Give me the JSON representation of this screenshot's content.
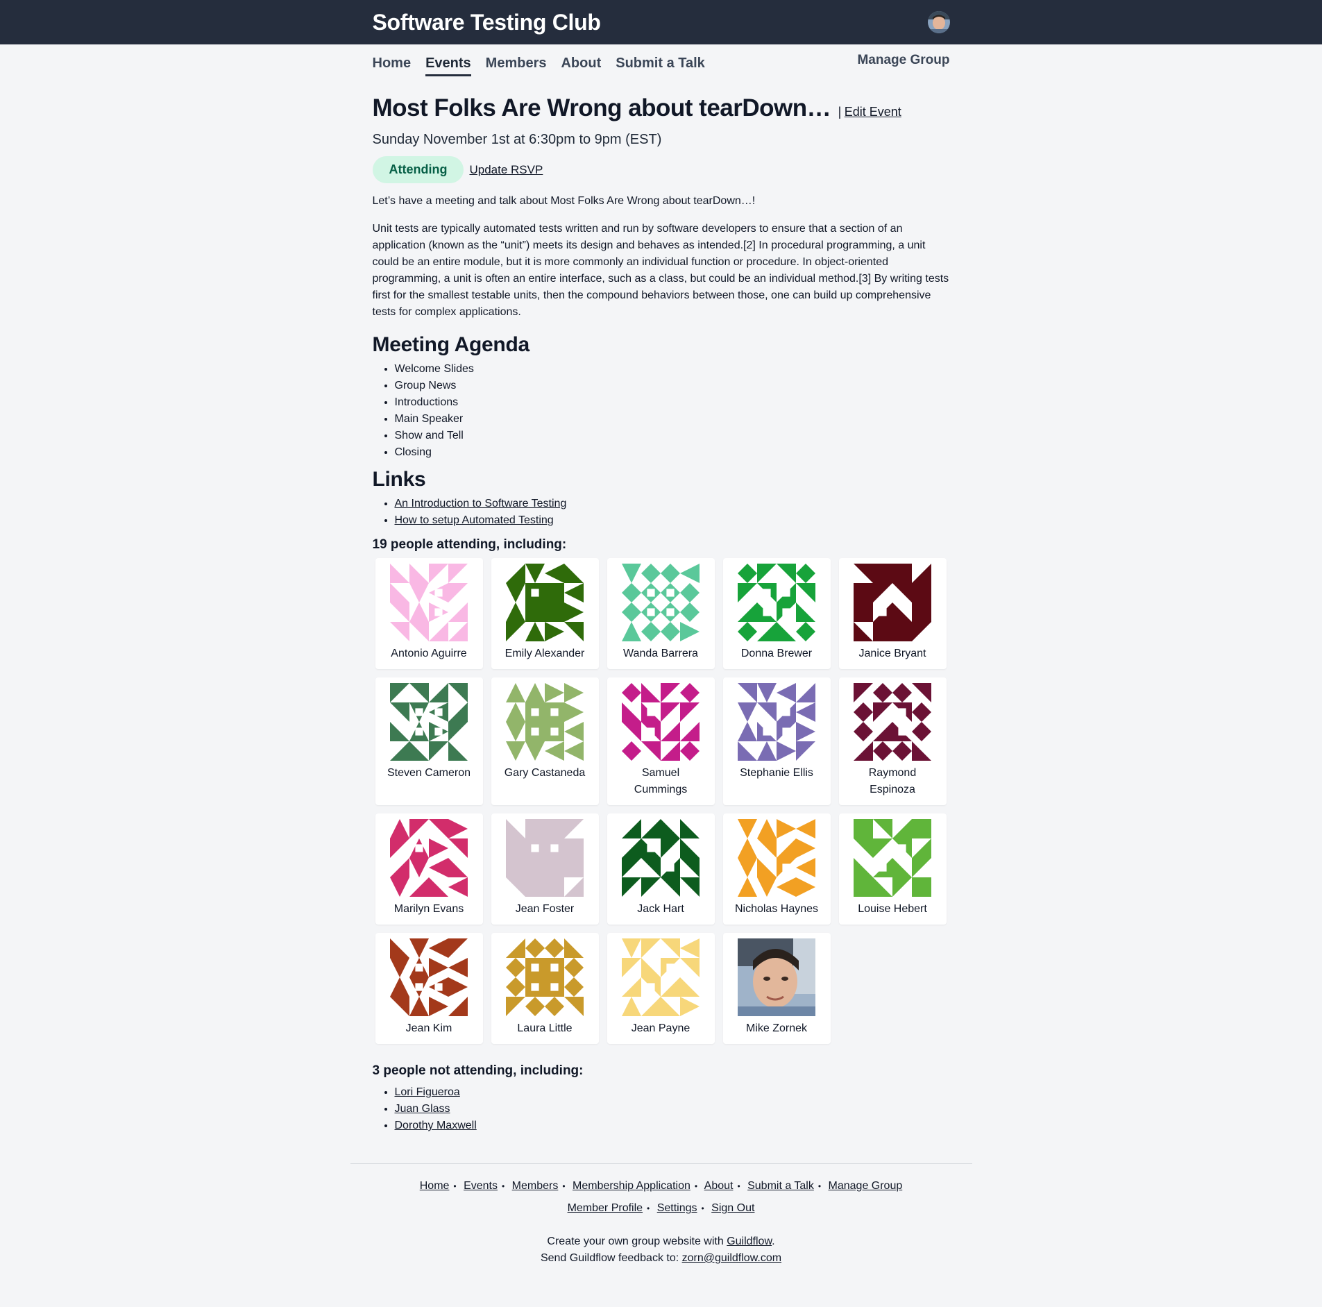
{
  "header": {
    "site_title": "Software Testing Club"
  },
  "nav": {
    "items": [
      {
        "label": "Home"
      },
      {
        "label": "Events"
      },
      {
        "label": "Members"
      },
      {
        "label": "About"
      },
      {
        "label": "Submit a Talk"
      }
    ],
    "active": "Events",
    "manage_label": "Manage Group"
  },
  "event": {
    "title": "Most Folks Are Wrong about tearDown…",
    "separator": "|",
    "edit_label": "Edit Event",
    "datetime": "Sunday November 1st at 6:30pm to 9pm (EST)",
    "status_badge": "Attending",
    "update_rsvp_label": "Update RSVP",
    "intro": "Let’s have a meeting and talk about Most Folks Are Wrong about tearDown…!",
    "description": "Unit tests are typically automated tests written and run by software developers to ensure that a section of an application (known as the “unit”) meets its design and behaves as intended.[2] In procedural programming, a unit could be an entire module, but it is more commonly an individual function or procedure. In object-oriented programming, a unit is often an entire interface, such as a class, but could be an individual method.[3] By writing tests first for the smallest testable units, then the compound behaviors between those, one can build up comprehensive tests for complex applications."
  },
  "agenda": {
    "heading": "Meeting Agenda",
    "items": [
      "Welcome Slides",
      "Group News",
      "Introductions",
      "Main Speaker",
      "Show and Tell",
      "Closing"
    ]
  },
  "links": {
    "heading": "Links",
    "items": [
      "An Introduction to Software Testing",
      "How to setup Automated Testing"
    ]
  },
  "attending": {
    "heading": "19 people attending, including:",
    "people": [
      {
        "name": "Antonio Aguirre",
        "color": "#f9b8e4"
      },
      {
        "name": "Emily Alexander",
        "color": "#2f6b0a"
      },
      {
        "name": "Wanda Barrera",
        "color": "#5ac89a"
      },
      {
        "name": "Donna Brewer",
        "color": "#17a33a"
      },
      {
        "name": "Janice Bryant",
        "color": "#5c0a14"
      },
      {
        "name": "Steven Cameron",
        "color": "#3d7a52"
      },
      {
        "name": "Gary Castaneda",
        "color": "#92b56a"
      },
      {
        "name": "Samuel Cummings",
        "color": "#c41d8a"
      },
      {
        "name": "Stephanie Ellis",
        "color": "#7a6cb3"
      },
      {
        "name": "Raymond Espinoza",
        "color": "#6b1235"
      },
      {
        "name": "Marilyn Evans",
        "color": "#d22d6b"
      },
      {
        "name": "Jean Foster",
        "color": "#d4c4cf"
      },
      {
        "name": "Jack Hart",
        "color": "#0d5c1e"
      },
      {
        "name": "Nicholas Haynes",
        "color": "#f2a023"
      },
      {
        "name": "Louise Hebert",
        "color": "#60b53a"
      },
      {
        "name": "Jean Kim",
        "color": "#a3391b"
      },
      {
        "name": "Laura Little",
        "color": "#c99a2b"
      },
      {
        "name": "Jean Payne",
        "color": "#f7d77a"
      },
      {
        "name": "Mike Zornek",
        "color": "photo"
      }
    ]
  },
  "not_attending": {
    "heading": "3 people not attending, including:",
    "people": [
      "Lori Figueroa",
      "Juan Glass",
      "Dorothy Maxwell"
    ]
  },
  "footer": {
    "row1": [
      "Home",
      "Events",
      "Members",
      "Membership Application",
      "About",
      "Submit a Talk",
      "Manage Group"
    ],
    "row2": [
      "Member Profile",
      "Settings",
      "Sign Out"
    ],
    "credit_prefix": "Create your own group website with ",
    "credit_link": "Guildflow",
    "credit_suffix": ".",
    "feedback_prefix": "Send Guildflow feedback to: ",
    "feedback_link": "zorn@guildflow.com"
  }
}
